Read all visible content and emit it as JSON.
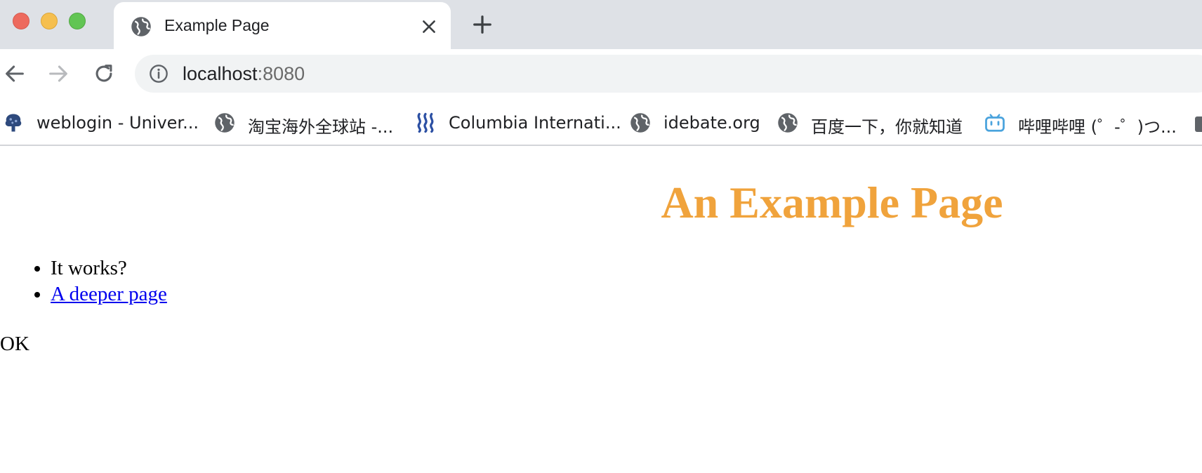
{
  "window": {
    "traffic_lights": {
      "close_color": "#ed6a5e",
      "minimize_color": "#f5bf4f",
      "maximize_color": "#62c554"
    }
  },
  "tab": {
    "title": "Example Page",
    "icon": "globe-icon",
    "close_icon": "close-icon"
  },
  "new_tab_icon": "plus-icon",
  "toolbar": {
    "back_icon": "arrow-left-icon",
    "forward_icon": "arrow-right-icon",
    "reload_icon": "reload-icon",
    "url_host": "localhost",
    "url_port": ":8080",
    "site_info_icon": "info-icon"
  },
  "bookmarks": [
    {
      "label": "weblogin - Univer...",
      "icon": "tree-icon"
    },
    {
      "label": "淘宝海外全球站 -...",
      "icon": "globe-icon"
    },
    {
      "label": "Columbia Internati...",
      "icon": "waves-icon"
    },
    {
      "label": "idebate.org",
      "icon": "globe-icon"
    },
    {
      "label": "百度一下，你就知道",
      "icon": "globe-icon"
    },
    {
      "label": "哔哩哔哩 (゜-゜)つ...",
      "icon": "bilibili-icon"
    }
  ],
  "page": {
    "heading": "An Example Page",
    "heading_color": "#f0a33c",
    "list_items": [
      "It works?",
      "A deeper page"
    ],
    "link_color": "#0000ee",
    "footer_text": "OK"
  }
}
